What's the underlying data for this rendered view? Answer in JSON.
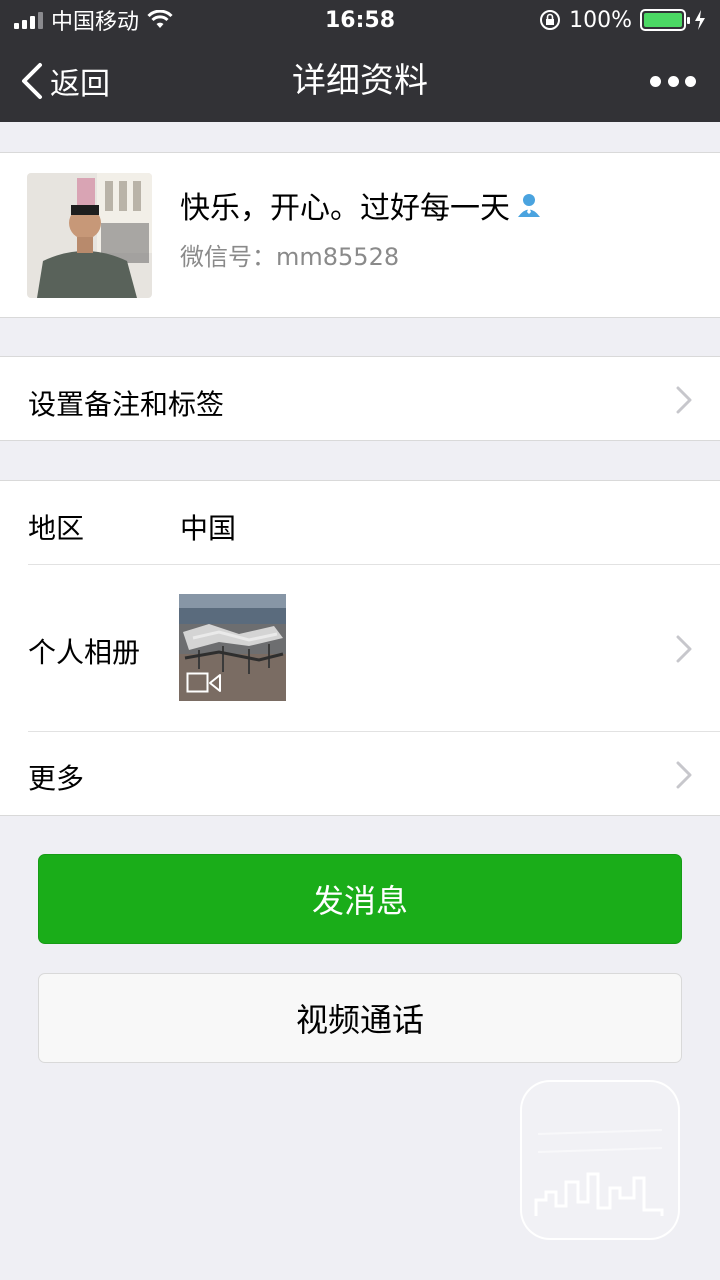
{
  "status_bar": {
    "carrier": "中国移动",
    "time": "16:58",
    "battery_percent": "100%",
    "battery_level": 1.0
  },
  "nav": {
    "back_label": "返回",
    "title": "详细资料",
    "more_icon": "more-dots-icon"
  },
  "profile": {
    "name": "快乐，开心。过好每一天",
    "wechat_id": "微信号：mm85528",
    "gender_icon": "person-icon"
  },
  "remark": {
    "label": "设置备注和标签"
  },
  "info": {
    "region_label": "地区",
    "region_value": "中国",
    "album_label": "个人相册",
    "more_label": "更多"
  },
  "actions": {
    "send_message": "发消息",
    "video_call": "视频通话"
  },
  "colors": {
    "nav_bg": "#323236",
    "primary_green": "#1aad19",
    "page_bg": "#efeff4"
  }
}
